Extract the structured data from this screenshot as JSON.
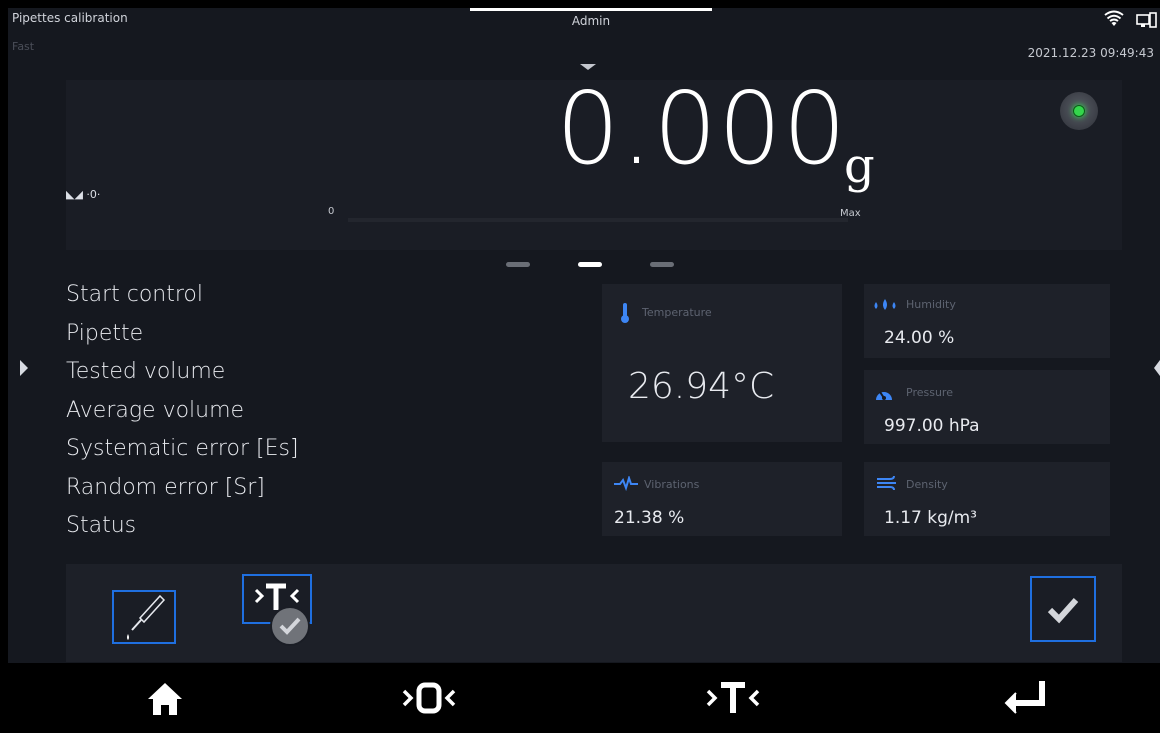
{
  "header": {
    "title": "Pipettes calibration",
    "mode": "Fast",
    "user": "Admin",
    "datetime": "2021.12.23 09:49:43"
  },
  "weighing": {
    "value": "0.000",
    "unit": "g",
    "bargraph_min": "0",
    "bargraph_max": "Max",
    "zero_indicator": "◣◢ ·0·"
  },
  "info_list": {
    "items": [
      "Start control",
      "Pipette",
      "Tested volume",
      "Average volume",
      "Systematic error [Es]",
      "Random error [Sr]",
      "Status"
    ]
  },
  "environment": {
    "temperature": {
      "label": "Temperature",
      "value": "26.94°C"
    },
    "humidity": {
      "label": "Humidity",
      "value": "24.00 %"
    },
    "pressure": {
      "label": "Pressure",
      "value": "997.00 hPa"
    },
    "vibrations": {
      "label": "Vibrations",
      "value": "21.38 %"
    },
    "density": {
      "label": "Density",
      "value": "1.17 kg/m³"
    }
  },
  "colors": {
    "accent": "#1f6fe0",
    "led_ok": "#34d64c",
    "icon_blue": "#3d86f5"
  },
  "icons": {
    "home": "home-icon",
    "zero": "zero-icon",
    "tare": "tare-icon",
    "enter": "enter-icon"
  }
}
